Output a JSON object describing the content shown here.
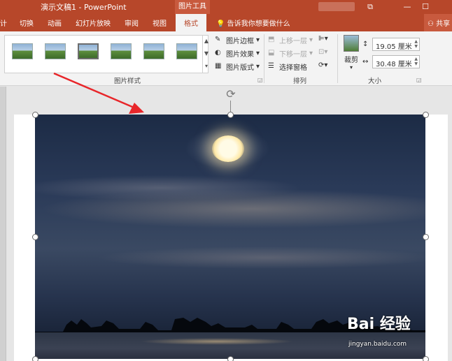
{
  "titlebar": {
    "title": "演示文稿1  -  PowerPoint",
    "context_tab": "图片工具",
    "controls": [
      "⧉",
      "—",
      "☐"
    ]
  },
  "tabs": {
    "items": [
      "计",
      "切换",
      "动画",
      "幻灯片放映",
      "审阅",
      "视图",
      "格式"
    ],
    "active": "格式",
    "tell_me": "告诉我你想要做什么",
    "share": "共享"
  },
  "ribbon": {
    "picture_styles_label": "图片样式",
    "border": "图片边框",
    "effects": "图片效果",
    "layout": "图片版式",
    "bring_forward": "上移一层",
    "send_backward": "下移一层",
    "selection_pane": "选择窗格",
    "arrange_label": "排列",
    "crop": "裁剪",
    "height_value": "19.05 厘米",
    "width_value": "30.48 厘米",
    "size_label": "大小"
  },
  "watermark": {
    "brand": "Bai 经验",
    "url": "jingyan.baidu.com"
  }
}
